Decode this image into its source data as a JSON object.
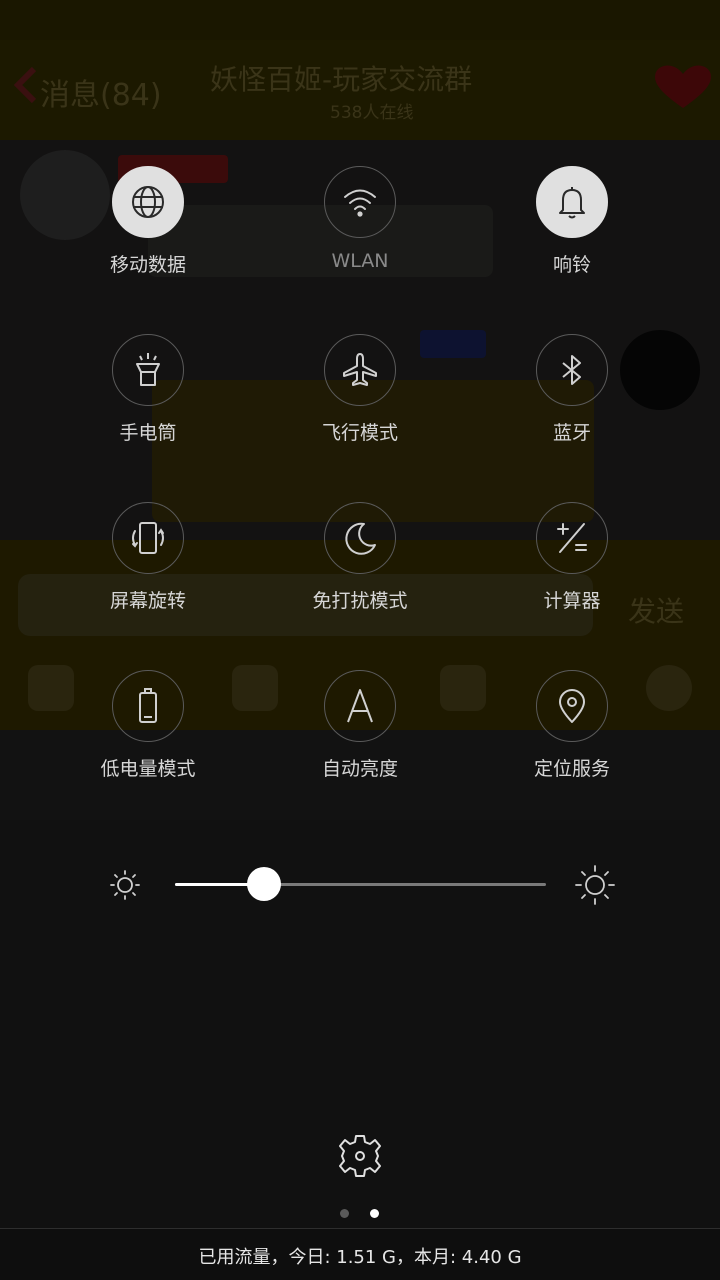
{
  "background_app": {
    "back_label": "消息(84)",
    "group_title": "妖怪百姬-玩家交流群",
    "online_count": "538人在线",
    "send_label": "发送"
  },
  "tiles": [
    {
      "label": "移动数据",
      "icon": "globe-icon",
      "state": "on"
    },
    {
      "label": "WLAN",
      "icon": "wifi-icon",
      "state": "off"
    },
    {
      "label": "响铃",
      "icon": "bell-icon",
      "state": "on"
    },
    {
      "label": "手电筒",
      "icon": "flashlight-icon",
      "state": "off"
    },
    {
      "label": "飞行模式",
      "icon": "airplane-icon",
      "state": "off"
    },
    {
      "label": "蓝牙",
      "icon": "bluetooth-icon",
      "state": "off"
    },
    {
      "label": "屏幕旋转",
      "icon": "rotate-icon",
      "state": "off"
    },
    {
      "label": "免打扰模式",
      "icon": "moon-icon",
      "state": "off"
    },
    {
      "label": "计算器",
      "icon": "calculator-icon",
      "state": "off"
    },
    {
      "label": "低电量模式",
      "icon": "battery-icon",
      "state": "off"
    },
    {
      "label": "自动亮度",
      "icon": "auto-brightness-icon",
      "state": "off"
    },
    {
      "label": "定位服务",
      "icon": "location-icon",
      "state": "off"
    }
  ],
  "brightness": {
    "level": 0.24
  },
  "page_indicator": {
    "pages": 2,
    "current": 2
  },
  "footer": {
    "data_usage": "已用流量，今日: 1.51 G，本月: 4.40 G"
  },
  "colors": {
    "tile_on": "#e0e0e0",
    "tile_border": "#5a5a5a",
    "slider_active": "#ffffff"
  }
}
